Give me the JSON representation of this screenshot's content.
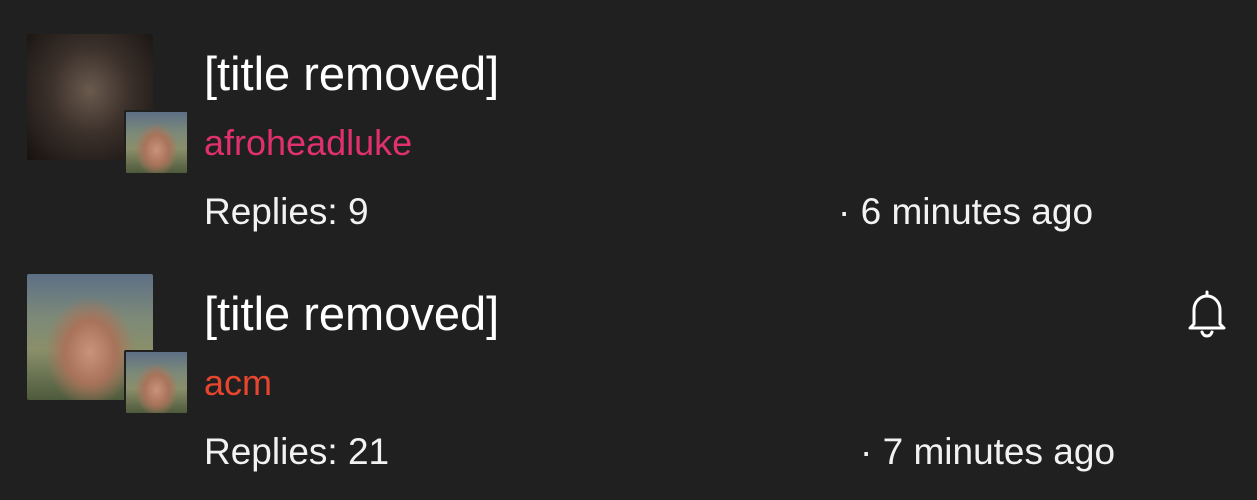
{
  "colors": {
    "background": "#202020",
    "text": "#ffffff",
    "username_1": "#e0306e",
    "username_2": "#e8452f"
  },
  "threads": [
    {
      "title": "[title removed]",
      "username": "afroheadluke",
      "replies": "Replies: 9",
      "time": "· 6 minutes ago",
      "avatar_main": "portrait-photo",
      "avatar_small": "portrait-photo",
      "notify_icon": null
    },
    {
      "title": "[title removed]",
      "username": "acm",
      "replies": "Replies: 21",
      "time": "· 7 minutes ago",
      "avatar_main": "portrait-photo",
      "avatar_small": "portrait-photo",
      "notify_icon": "bell-icon"
    }
  ]
}
